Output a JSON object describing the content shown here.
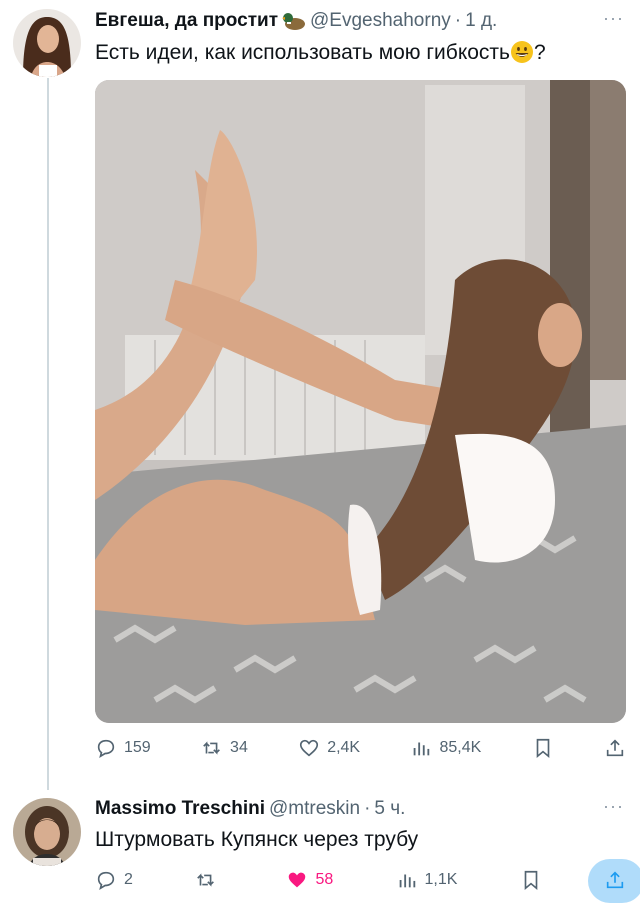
{
  "tweet1": {
    "display_name": "Евгеша, да простит",
    "handle": "@Evgeshahorny",
    "separator": "·",
    "time": "1 д.",
    "more": "···",
    "text_before": "Есть идеи, как использовать мою гибкость",
    "text_after": "?",
    "stats": {
      "replies": "159",
      "retweets": "34",
      "likes": "2,4K",
      "views": "85,4K"
    }
  },
  "tweet2": {
    "display_name": "Massimo Treschini",
    "handle": "@mtreskin",
    "separator": "·",
    "time": "5 ч.",
    "more": "···",
    "text": "Штурмовать Купянск через трубу",
    "stats": {
      "replies": "2",
      "retweets": "",
      "likes": "58",
      "views": "1,1K"
    }
  },
  "colors": {
    "like_active": "#f91880",
    "share_highlight": "#1d9bf0",
    "secondary_text": "#536471"
  },
  "icons": [
    "reply-icon",
    "retweet-icon",
    "like-icon",
    "views-icon",
    "bookmark-icon",
    "share-icon"
  ]
}
